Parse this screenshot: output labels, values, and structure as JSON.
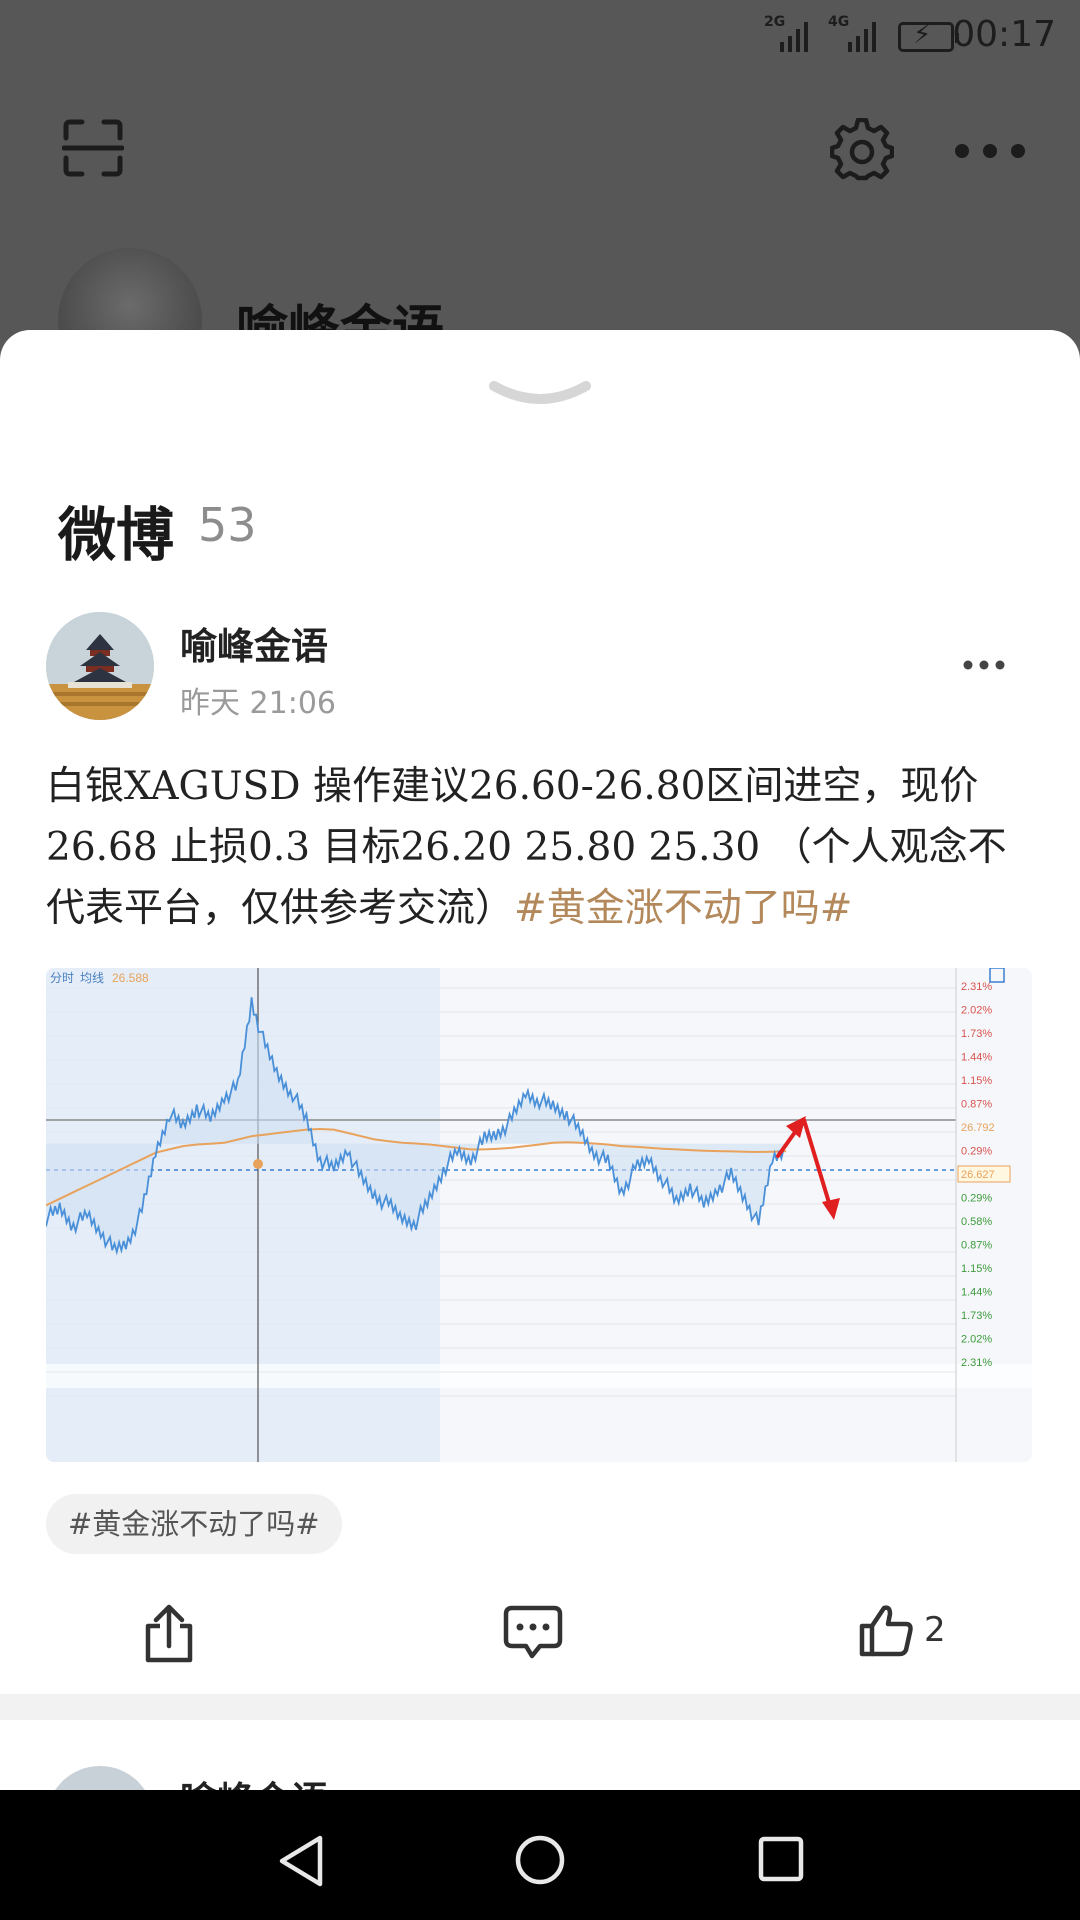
{
  "status_bar": {
    "time": "00:17",
    "signal_1": "2G",
    "signal_2": "4G"
  },
  "profile_bg": {
    "name": "喻峰金语"
  },
  "sheet": {
    "title": "微博",
    "count": "53"
  },
  "post": {
    "author": "喻峰金语",
    "time": "昨天 21:06",
    "text": "白银XAGUSD 操作建议26.60-26.80区间进空，现价26.68 止损0.3 目标26.20 25.80 25.30 （个人观念不代表平台，仅供参考交流）",
    "hashtag": "#黄金涨不动了吗#",
    "tag_pill": "#黄金涨不动了吗#",
    "like_count": "2"
  },
  "next_post": {
    "author": "喻峰金语"
  },
  "chart_data": {
    "type": "line",
    "header_label": "分时",
    "avg_label": "均线",
    "avg_value": "26.588",
    "reference_price": 26.627,
    "marked_price": "26.792",
    "current_price_label": "26.627",
    "right_axis_labels_up": [
      "2.31%",
      "2.02%",
      "1.73%",
      "1.44%",
      "1.15%",
      "0.87%",
      "26.792",
      "0.29%"
    ],
    "right_axis_labels_down": [
      "26.627",
      "0.29%",
      "0.58%",
      "0.87%",
      "1.15%",
      "1.44%",
      "1.73%",
      "2.02%",
      "2.31%"
    ],
    "price_series": [
      26.4,
      26.43,
      26.38,
      26.41,
      26.36,
      26.3,
      26.33,
      26.42,
      26.6,
      26.72,
      26.68,
      26.74,
      26.7,
      26.77,
      26.8,
      27.06,
      26.92,
      26.83,
      26.78,
      26.7,
      26.58,
      26.55,
      26.61,
      26.52,
      26.47,
      26.44,
      26.4,
      26.39,
      26.46,
      26.55,
      26.6,
      26.58,
      26.64,
      26.66,
      26.7,
      26.78,
      26.76,
      26.74,
      26.72,
      26.66,
      26.6,
      26.57,
      26.48,
      26.55,
      26.58,
      26.52,
      26.45,
      26.5,
      26.44,
      26.49,
      26.53,
      26.46,
      26.38,
      26.58,
      26.62
    ],
    "avg_series": [
      26.44,
      26.46,
      26.48,
      26.5,
      26.52,
      26.54,
      26.56,
      26.58,
      26.6,
      26.61,
      26.62,
      26.625,
      26.627,
      26.63,
      26.64,
      26.65,
      26.655,
      26.66,
      26.665,
      26.67,
      26.672,
      26.67,
      26.66,
      26.65,
      26.64,
      26.635,
      26.63,
      26.628,
      26.625,
      26.62,
      26.615,
      26.61,
      26.61,
      26.612,
      26.615,
      26.62,
      26.625,
      26.63,
      26.632,
      26.63,
      26.628,
      26.625,
      26.62,
      26.618,
      26.615,
      26.612,
      26.61,
      26.608,
      26.606,
      26.605,
      26.604,
      26.603,
      26.602,
      26.603,
      26.605
    ],
    "ylim": [
      26.25,
      27.1
    ],
    "annotations": [
      "red-up-arrow",
      "red-down-arrow"
    ],
    "colors": {
      "price": "#4a90d9",
      "avg": "#e8a25c",
      "up": "#d9534f",
      "down": "#3c9a3c",
      "arrow": "#e02020"
    }
  },
  "colors": {
    "hashtag": "#b3895b"
  }
}
